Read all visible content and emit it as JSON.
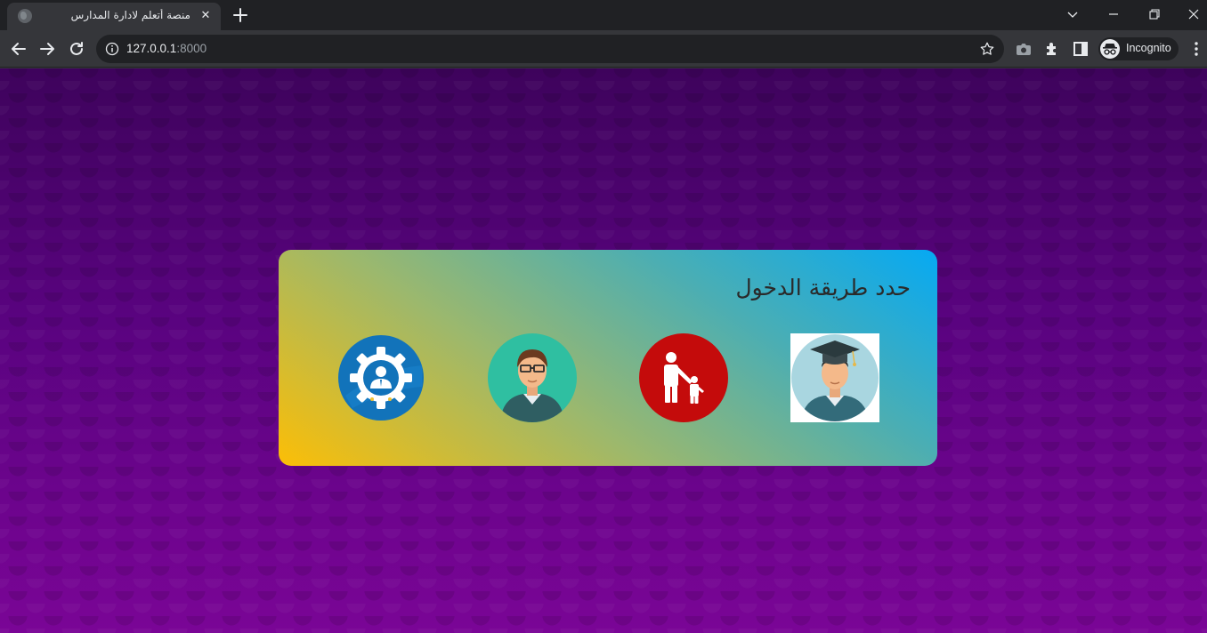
{
  "browser": {
    "tab_title": "منصة أتعلم لادارة المدارس",
    "tab_close": "✕",
    "url_host": "127.0.0.1",
    "url_port": ":8000",
    "profile_label": "Incognito"
  },
  "page": {
    "heading": "حدد طريقة الدخول",
    "roles": [
      {
        "icon": "graduate-student-icon"
      },
      {
        "icon": "parent-child-icon"
      },
      {
        "icon": "teacher-icon"
      },
      {
        "icon": "admin-gear-icon"
      }
    ]
  },
  "colors": {
    "page_bg_top": "#3e035c",
    "page_bg_bottom": "#7a0596",
    "card_gradient_start": "#06a9f3",
    "card_gradient_end": "#fcbe06",
    "parent_circle": "#c40b0b",
    "admin_circle": "#1273ba",
    "teacher_circle": "#2fbfa1"
  }
}
